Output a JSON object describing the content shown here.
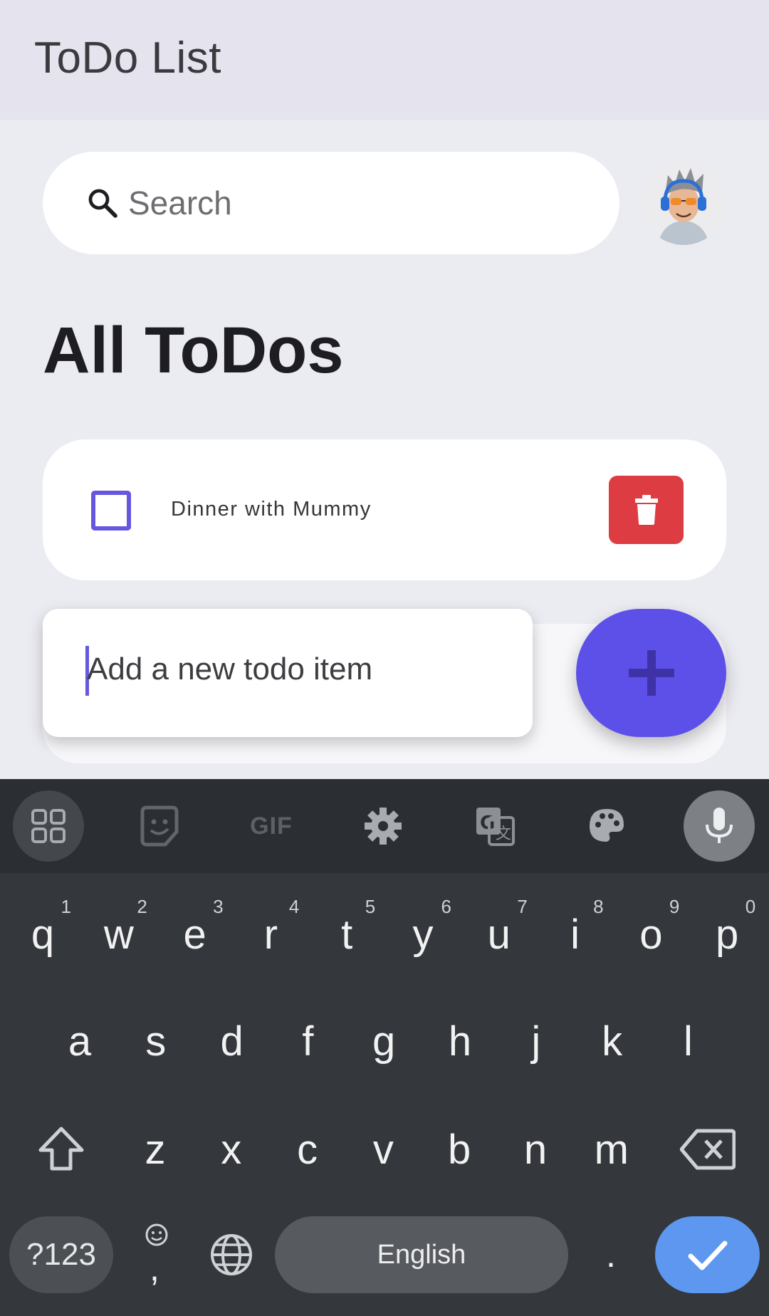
{
  "appbar": {
    "title": "ToDo List"
  },
  "search": {
    "placeholder": "Search"
  },
  "main": {
    "heading": "All ToDos"
  },
  "todos": [
    {
      "text": "Dinner with Mummy",
      "done": false
    }
  ],
  "add_todo": {
    "placeholder": "Add a new todo item"
  },
  "fab": {
    "icon": "plus-icon"
  },
  "colors": {
    "accent": "#5d50e8",
    "delete": "#dc3c42",
    "enter_key": "#5d97f0"
  },
  "keyboard": {
    "toolbar": [
      "apps-grid-icon",
      "sticker-icon",
      "GIF",
      "settings-icon",
      "translate-icon",
      "palette-icon",
      "mic-icon"
    ],
    "row1": [
      {
        "k": "q",
        "n": "1"
      },
      {
        "k": "w",
        "n": "2"
      },
      {
        "k": "e",
        "n": "3"
      },
      {
        "k": "r",
        "n": "4"
      },
      {
        "k": "t",
        "n": "5"
      },
      {
        "k": "y",
        "n": "6"
      },
      {
        "k": "u",
        "n": "7"
      },
      {
        "k": "i",
        "n": "8"
      },
      {
        "k": "o",
        "n": "9"
      },
      {
        "k": "p",
        "n": "0"
      }
    ],
    "row2": [
      "a",
      "s",
      "d",
      "f",
      "g",
      "h",
      "j",
      "k",
      "l"
    ],
    "row3": [
      "z",
      "x",
      "c",
      "v",
      "b",
      "n",
      "m"
    ],
    "symbols_label": "?123",
    "comma_label": ",",
    "space_label": "English",
    "period_label": "."
  }
}
